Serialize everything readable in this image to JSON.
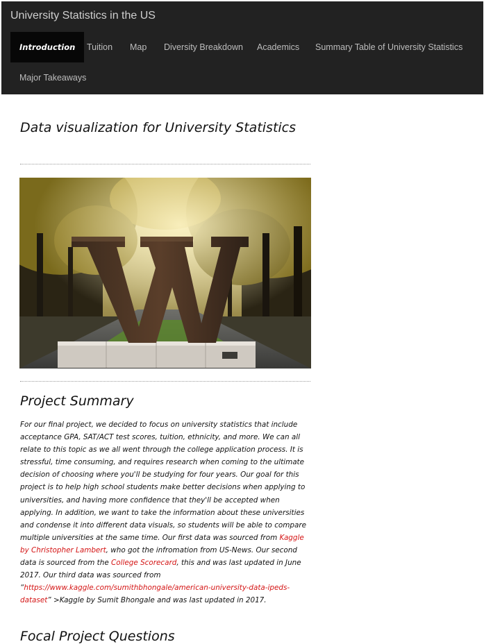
{
  "navbar": {
    "brand": "University Statistics in the US",
    "items": [
      {
        "label": "Introduction"
      },
      {
        "label": "Tuition"
      },
      {
        "label": "Map"
      },
      {
        "label": "Diversity Breakdown"
      },
      {
        "label": "Academics"
      },
      {
        "label": "Summary Table of University Statistics"
      },
      {
        "label": "Major Takeaways"
      }
    ]
  },
  "main": {
    "title": "Data visualization for University Statistics",
    "hero_image_alt": "W",
    "summary_heading": "Project Summary",
    "summary": {
      "p1": "For our final project, we decided to focus on university statistics that include acceptance GPA, SAT/ACT test scores, tuition, ethnicity, and more. We can all relate to this topic as we all went through the college application process. It is stressful, time consuming, and requires research when coming to the ultimate decision of choosing where you'll be studying for four years. Our goal for this project is to help high school students make better decisions when applying to universities, and having more confidence that they'll be accepted when applying. In addition, we want to take the information about these universities and condense it into different data visuals, so students will be able to compare multiple universities at the same time. Our first data was sourced from ",
      "link1": "Kaggle by Christopher Lambert",
      "p2": ", who got the infromation from US-News. Our second data is sourced from the ",
      "link2": "College Scorecard",
      "p3": ", this and was last updated in June 2017. Our third data was sourced from “",
      "link3": "https://www.kaggle.com/sumithbhongale/american-university-data-ipeds-dataset",
      "p4": "” >Kaggle by Sumit Bhongale and was last updated in 2017."
    },
    "next_heading": "Focal Project Questions"
  },
  "colors": {
    "navbar_bg": "#222222",
    "active_bg": "#070707",
    "link": "#d41414"
  }
}
